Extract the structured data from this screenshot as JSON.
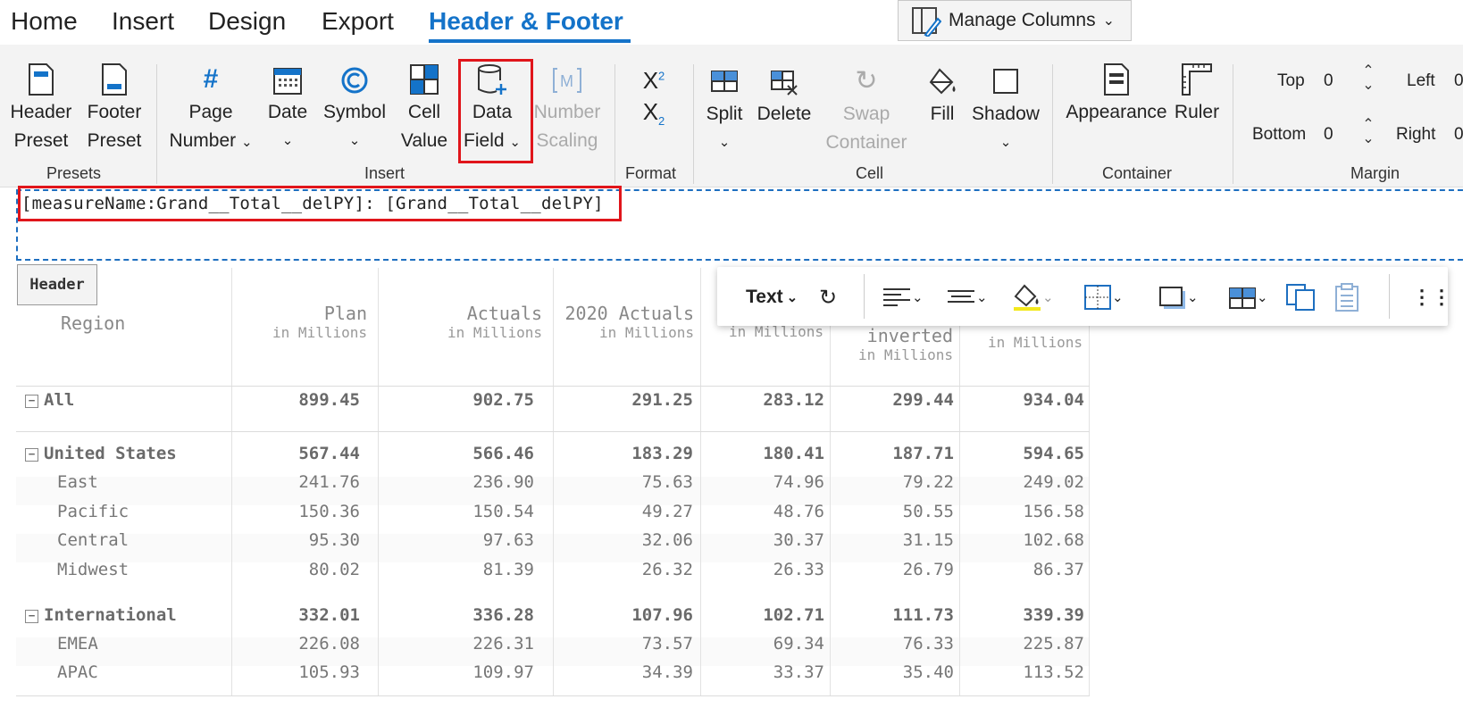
{
  "tabs": [
    {
      "label": "Home"
    },
    {
      "label": "Insert"
    },
    {
      "label": "Design"
    },
    {
      "label": "Export"
    },
    {
      "label": "Header & Footer"
    }
  ],
  "manage_columns": {
    "label": "Manage Columns"
  },
  "ribbon": {
    "presets": {
      "group": "Presets",
      "header_preset": {
        "line1": "Header",
        "line2": "Preset"
      },
      "footer_preset": {
        "line1": "Footer",
        "line2": "Preset"
      }
    },
    "insert": {
      "group": "Insert",
      "page_number": {
        "line1": "Page",
        "line2": "Number"
      },
      "date": {
        "line1": "Date"
      },
      "symbol": {
        "line1": "Symbol"
      },
      "cell_value": {
        "line1": "Cell",
        "line2": "Value"
      },
      "data_field": {
        "line1": "Data",
        "line2": "Field"
      },
      "number_scaling": {
        "line1": "Number",
        "line2": "Scaling"
      }
    },
    "format": {
      "group": "Format",
      "superscript": "X",
      "sup_mark": "2",
      "subscript": "X",
      "sub_mark": "2"
    },
    "cell": {
      "group": "Cell",
      "split": "Split",
      "delete": "Delete",
      "swap_container": {
        "line1": "Swap",
        "line2": "Container"
      },
      "fill": "Fill",
      "shadow": "Shadow"
    },
    "container": {
      "group": "Container",
      "appearance": "Appearance",
      "ruler": "Ruler"
    },
    "margin": {
      "group": "Margin",
      "top_label": "Top",
      "top_value": "0",
      "bottom_label": "Bottom",
      "bottom_value": "0",
      "left_label": "Left",
      "left_value": "0",
      "right_label": "Right",
      "right_value": "0"
    }
  },
  "header_editor": {
    "text": "[measureName:Grand__Total__delPY]: [Grand__Total__delPY]",
    "tag": "Header"
  },
  "float_toolbar": {
    "text_label": "Text"
  },
  "table": {
    "region_header": "Region",
    "columns": [
      {
        "title": "Plan",
        "sub": "in Millions"
      },
      {
        "title": "Actuals",
        "sub": "in Millions"
      },
      {
        "title": "2020 Actuals",
        "sub": "in Millions"
      },
      {
        "title": "",
        "sub": "in Millions"
      },
      {
        "title": "inverted",
        "sub": "in Millions"
      },
      {
        "title": "",
        "sub": "in Millions"
      }
    ],
    "rows": [
      {
        "label": "All",
        "bold": true,
        "collapse": true,
        "values": [
          "899.45",
          "902.75",
          "291.25",
          "283.12",
          "299.44",
          "934.04"
        ]
      },
      {
        "label": "United States",
        "bold": true,
        "collapse": true,
        "values": [
          "567.44",
          "566.46",
          "183.29",
          "180.41",
          "187.71",
          "594.65"
        ]
      },
      {
        "label": "East",
        "values": [
          "241.76",
          "236.90",
          "75.63",
          "74.96",
          "79.22",
          "249.02"
        ]
      },
      {
        "label": "Pacific",
        "values": [
          "150.36",
          "150.54",
          "49.27",
          "48.76",
          "50.55",
          "156.58"
        ]
      },
      {
        "label": "Central",
        "values": [
          "95.30",
          "97.63",
          "32.06",
          "30.37",
          "31.15",
          "102.68"
        ]
      },
      {
        "label": "Midwest",
        "values": [
          "80.02",
          "81.39",
          "26.32",
          "26.33",
          "26.79",
          "86.37"
        ]
      },
      {
        "label": "International",
        "bold": true,
        "collapse": true,
        "values": [
          "332.01",
          "336.28",
          "107.96",
          "102.71",
          "111.73",
          "339.39"
        ]
      },
      {
        "label": "EMEA",
        "values": [
          "226.08",
          "226.31",
          "73.57",
          "69.34",
          "76.33",
          "225.87"
        ]
      },
      {
        "label": "APAC",
        "values": [
          "105.93",
          "109.97",
          "34.39",
          "33.37",
          "35.40",
          "113.52"
        ]
      }
    ]
  }
}
